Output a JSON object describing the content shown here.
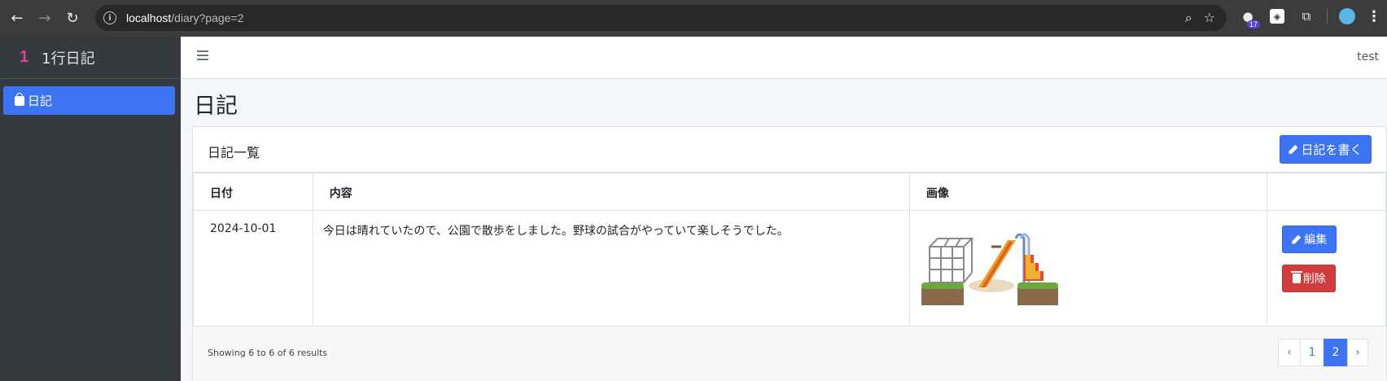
{
  "browser": {
    "url_host": "localhost",
    "url_path": "/diary?page=2",
    "extension_badge": "17"
  },
  "sidebar": {
    "brand_logo": "1",
    "brand_text": "1行日記",
    "items": [
      {
        "label": "日記"
      }
    ]
  },
  "topbar": {
    "user": "test"
  },
  "page": {
    "title": "日記"
  },
  "card": {
    "title": "日記一覧",
    "write_button": "日記を書く"
  },
  "table": {
    "headers": [
      "日付",
      "内容",
      "画像",
      ""
    ],
    "rows": [
      {
        "date": "2024-10-01",
        "content": "今日は晴れていたので、公園で散歩をしました。野球の試合がやっていて楽しそうでした。",
        "edit_label": "編集",
        "delete_label": "削除"
      }
    ]
  },
  "footer": {
    "showing": "Showing 6 to 6 of 6 results",
    "pagination": {
      "prev": "‹",
      "pages": [
        "1",
        "2"
      ],
      "current": "2",
      "next": "›"
    }
  },
  "colors": {
    "primary": "#3d73f5",
    "danger": "#d33c3c",
    "sidebar_bg": "#343a40",
    "brand_accent": "#e83e8c"
  }
}
